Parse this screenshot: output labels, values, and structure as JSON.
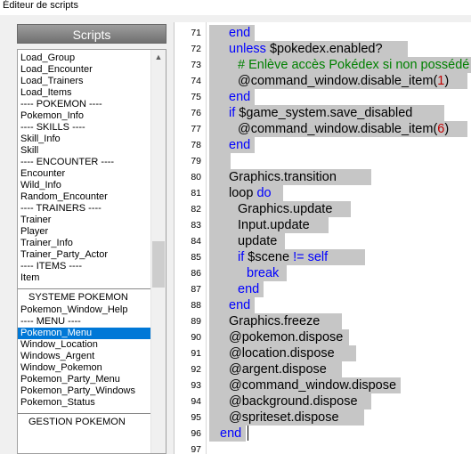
{
  "window": {
    "title": "Éditeur de scripts"
  },
  "sidebar": {
    "header": "Scripts",
    "items": [
      {
        "label": "Load_Group"
      },
      {
        "label": "Load_Encounter"
      },
      {
        "label": "Load_Trainers"
      },
      {
        "label": "Load_Items"
      },
      {
        "label": "---- POKEMON ----"
      },
      {
        "label": "Pokemon_Info"
      },
      {
        "label": "---- SKILLS ----"
      },
      {
        "label": "Skill_Info"
      },
      {
        "label": "Skill"
      },
      {
        "label": "---- ENCOUNTER ----"
      },
      {
        "label": "Encounter"
      },
      {
        "label": "Wild_Info"
      },
      {
        "label": "Random_Encounter"
      },
      {
        "label": "---- TRAINERS ----"
      },
      {
        "label": "Trainer"
      },
      {
        "label": "Player"
      },
      {
        "label": "Trainer_Info"
      },
      {
        "label": "Trainer_Party_Actor"
      },
      {
        "label": "---- ITEMS ----"
      },
      {
        "label": "Item"
      },
      {
        "label": "SYSTEME POKEMON",
        "separator": true
      },
      {
        "label": "Pokemon_Window_Help"
      },
      {
        "label": "---- MENU ----"
      },
      {
        "label": "Pokemon_Menu",
        "selected": true
      },
      {
        "label": "Window_Location"
      },
      {
        "label": "Windows_Argent"
      },
      {
        "label": "Window_Pokemon"
      },
      {
        "label": "Pokemon_Party_Menu"
      },
      {
        "label": "Pokemon_Party_Windows"
      },
      {
        "label": "Pokemon_Status"
      },
      {
        "label": "GESTION POKEMON",
        "separator": true
      }
    ]
  },
  "editor": {
    "lines": [
      {
        "n": "71",
        "indent": 1,
        "tokens": [
          {
            "t": "end",
            "c": "kw"
          }
        ]
      },
      {
        "n": "72",
        "indent": 1,
        "tokens": [
          {
            "t": "unless",
            "c": "kw"
          },
          {
            "t": " $pokedex.enabled?"
          }
        ]
      },
      {
        "n": "73",
        "indent": 2,
        "tokens": [
          {
            "t": "# Enlève accès Pokédex si non possédé",
            "c": "cm"
          }
        ]
      },
      {
        "n": "74",
        "indent": 2,
        "tokens": [
          {
            "t": "@command_window.disable_item("
          },
          {
            "t": "1",
            "c": "nm"
          },
          {
            "t": ")"
          }
        ]
      },
      {
        "n": "75",
        "indent": 1,
        "tokens": [
          {
            "t": "end",
            "c": "kw"
          }
        ]
      },
      {
        "n": "76",
        "indent": 1,
        "tokens": [
          {
            "t": "if",
            "c": "kw"
          },
          {
            "t": " $game_system.save_disabled"
          }
        ]
      },
      {
        "n": "77",
        "indent": 2,
        "tokens": [
          {
            "t": "@command_window.disable_item("
          },
          {
            "t": "6",
            "c": "nm"
          },
          {
            "t": ")"
          }
        ]
      },
      {
        "n": "78",
        "indent": 1,
        "tokens": [
          {
            "t": "end",
            "c": "kw"
          }
        ]
      },
      {
        "n": "79",
        "indent": 0,
        "tokens": [
          {
            "t": " "
          }
        ]
      },
      {
        "n": "80",
        "indent": 1,
        "tokens": [
          {
            "t": "Graphics.transition"
          }
        ]
      },
      {
        "n": "81",
        "indent": 1,
        "tokens": [
          {
            "t": "loop "
          },
          {
            "t": "do",
            "c": "kw"
          }
        ]
      },
      {
        "n": "82",
        "indent": 2,
        "tokens": [
          {
            "t": "Graphics.update"
          }
        ]
      },
      {
        "n": "83",
        "indent": 2,
        "tokens": [
          {
            "t": "Input.update"
          }
        ]
      },
      {
        "n": "84",
        "indent": 2,
        "tokens": [
          {
            "t": "update"
          }
        ]
      },
      {
        "n": "85",
        "indent": 2,
        "tokens": [
          {
            "t": "if",
            "c": "kw"
          },
          {
            "t": " $scene "
          },
          {
            "t": "!=",
            "c": "kw"
          },
          {
            "t": " "
          },
          {
            "t": "self",
            "c": "kw"
          }
        ]
      },
      {
        "n": "86",
        "indent": 3,
        "tokens": [
          {
            "t": "break",
            "c": "kw"
          }
        ]
      },
      {
        "n": "87",
        "indent": 2,
        "tokens": [
          {
            "t": "end",
            "c": "kw"
          }
        ]
      },
      {
        "n": "88",
        "indent": 1,
        "tokens": [
          {
            "t": "end",
            "c": "kw"
          }
        ]
      },
      {
        "n": "89",
        "indent": 1,
        "tokens": [
          {
            "t": "Graphics.freeze"
          }
        ]
      },
      {
        "n": "90",
        "indent": 1,
        "tokens": [
          {
            "t": "@pokemon.dispose"
          }
        ]
      },
      {
        "n": "91",
        "indent": 1,
        "tokens": [
          {
            "t": "@location.dispose"
          }
        ]
      },
      {
        "n": "92",
        "indent": 1,
        "tokens": [
          {
            "t": "@argent.dispose"
          }
        ]
      },
      {
        "n": "93",
        "indent": 1,
        "tokens": [
          {
            "t": "@command_window.dispose"
          }
        ]
      },
      {
        "n": "94",
        "indent": 1,
        "tokens": [
          {
            "t": "@background.dispose"
          }
        ]
      },
      {
        "n": "95",
        "indent": 1,
        "tokens": [
          {
            "t": "@spriteset.dispose"
          }
        ]
      },
      {
        "n": "96",
        "indent": 0,
        "tokens": [
          {
            "t": "end",
            "c": "kw"
          }
        ]
      },
      {
        "n": "97",
        "indent": 0,
        "tokens": []
      }
    ]
  },
  "colors": {
    "keyword": "#0000ff",
    "comment": "#008000",
    "number": "#c00000",
    "selection": "#c6c6c6",
    "list_selected": "#0078d7",
    "annotation": "#e00000"
  }
}
